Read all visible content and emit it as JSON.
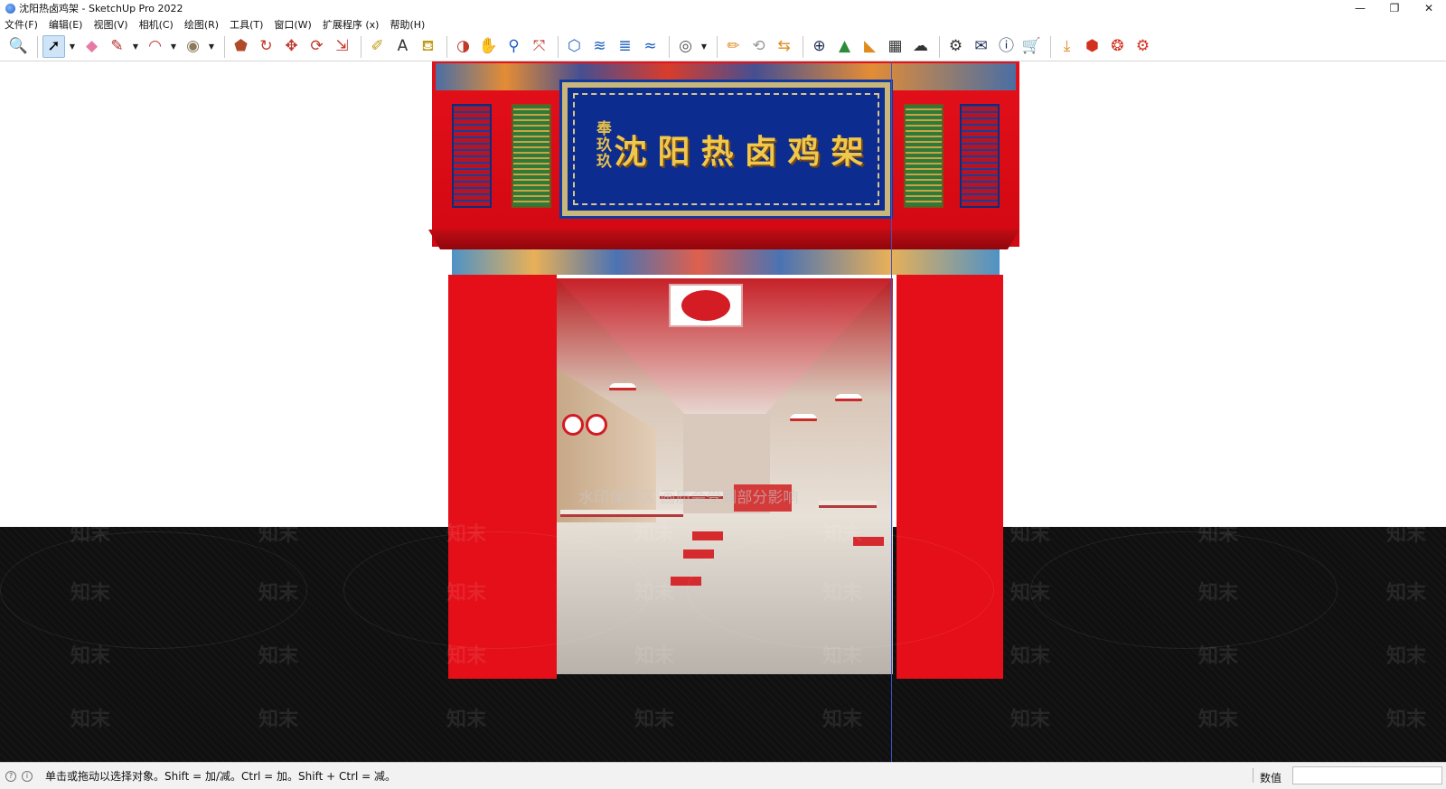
{
  "window": {
    "title": "沈阳热卤鸡架 - SketchUp Pro 2022",
    "controls": {
      "minimize": "—",
      "restore": "❐",
      "close": "✕"
    }
  },
  "menu": {
    "items": [
      "文件(F)",
      "编辑(E)",
      "视图(V)",
      "相机(C)",
      "绘图(R)",
      "工具(T)",
      "窗口(W)",
      "扩展程序 (x)",
      "帮助(H)"
    ]
  },
  "toolbar": {
    "accent": "#cfe4f7",
    "tools": [
      {
        "name": "zoom-extents-icon",
        "glyph": "🔍",
        "color": "#333333"
      },
      {
        "name": "select-icon",
        "glyph": "➚",
        "color": "#000000",
        "active": true
      },
      {
        "name": "eraser-icon",
        "glyph": "◆",
        "color": "#e77aa5"
      },
      {
        "name": "pencil-icon",
        "glyph": "✎",
        "color": "#b0302f"
      },
      {
        "name": "arc-icon",
        "glyph": "◠",
        "color": "#c0392b"
      },
      {
        "name": "shape-icon",
        "glyph": "◉",
        "color": "#8a7a5a"
      },
      {
        "name": "push-pull-icon",
        "glyph": "⬟",
        "color": "#b04a2a"
      },
      {
        "name": "offset-icon",
        "glyph": "↻",
        "color": "#c0392b"
      },
      {
        "name": "move-icon",
        "glyph": "✥",
        "color": "#c0392b"
      },
      {
        "name": "rotate-icon",
        "glyph": "⟳",
        "color": "#c0392b"
      },
      {
        "name": "scale-icon",
        "glyph": "⇲",
        "color": "#c0392b"
      },
      {
        "name": "tape-measure-icon",
        "glyph": "✐",
        "color": "#c49a15"
      },
      {
        "name": "text-icon",
        "glyph": "A",
        "color": "#333333"
      },
      {
        "name": "paint-bucket-icon",
        "glyph": "⛾",
        "color": "#c49a15"
      },
      {
        "name": "orbit-icon",
        "glyph": "◑",
        "color": "#c0392b"
      },
      {
        "name": "pan-icon",
        "glyph": "✋",
        "color": "#c49a15"
      },
      {
        "name": "zoom-icon",
        "glyph": "⚲",
        "color": "#1f5fbf"
      },
      {
        "name": "zoom-window-icon",
        "glyph": "⤧",
        "color": "#c0392b"
      },
      {
        "name": "warehouse-icon",
        "glyph": "⬡",
        "color": "#1f5fbf"
      },
      {
        "name": "extension-warehouse-icon",
        "glyph": "≋",
        "color": "#1f5fbf"
      },
      {
        "name": "layout-icon",
        "glyph": "≣",
        "color": "#1f5fbf"
      },
      {
        "name": "extension-manager-icon",
        "glyph": "≈",
        "color": "#1f5fbf"
      },
      {
        "name": "account-icon",
        "glyph": "◎",
        "color": "#555555"
      },
      {
        "name": "plugin-edit-icon",
        "glyph": "✏",
        "color": "#e08a1e"
      },
      {
        "name": "refresh-icon",
        "glyph": "⟲",
        "color": "#999999"
      },
      {
        "name": "transfer-icon",
        "glyph": "⇆",
        "color": "#e08a1e"
      },
      {
        "name": "add-circle-icon",
        "glyph": "⊕",
        "color": "#1a2a55"
      },
      {
        "name": "tree-icon",
        "glyph": "▲",
        "color": "#2e8b3a"
      },
      {
        "name": "stairs-icon",
        "glyph": "◣",
        "color": "#e08a1e"
      },
      {
        "name": "checker-icon",
        "glyph": "▦",
        "color": "#333333"
      },
      {
        "name": "cloud-upload-icon",
        "glyph": "☁",
        "color": "#333333"
      },
      {
        "name": "settings-icon",
        "glyph": "⚙",
        "color": "#333333"
      },
      {
        "name": "mail-icon",
        "glyph": "✉",
        "color": "#1a2a55"
      },
      {
        "name": "info-icon",
        "glyph": "ⓘ",
        "color": "#1a2a55"
      },
      {
        "name": "cart-icon",
        "glyph": "🛒",
        "color": "#333333"
      },
      {
        "name": "download-icon",
        "glyph": "⤓",
        "color": "#e08a1e"
      },
      {
        "name": "box-icon",
        "glyph": "⬢",
        "color": "#d2301f"
      },
      {
        "name": "paint-icon",
        "glyph": "❂",
        "color": "#d2301f"
      },
      {
        "name": "gear-orange-icon",
        "glyph": "⚙",
        "color": "#d2301f"
      }
    ]
  },
  "scene": {
    "sign": {
      "main": "沈阳热卤鸡架",
      "sub": "奉玖玖"
    },
    "watermark_text": "知末",
    "overlay_text": "水印保护区 画质会受到部分影响",
    "colors": {
      "facade_red": "#e40f18",
      "sign_blue": "#0d2c8f",
      "gold": "#f0c84c"
    }
  },
  "status": {
    "hint": "单击或拖动以选择对象。Shift = 加/减。Ctrl = 加。Shift + Ctrl = 减。",
    "measure_label": "数值",
    "measure_value": ""
  }
}
